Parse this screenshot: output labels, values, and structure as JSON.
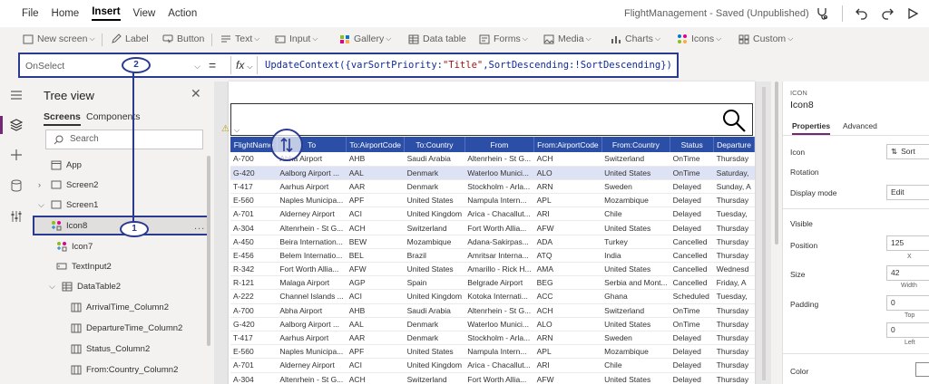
{
  "menu": {
    "items": [
      "File",
      "Home",
      "Insert",
      "View",
      "Action"
    ],
    "active": "Insert",
    "app_title": "FlightManagement - Saved (Unpublished)"
  },
  "toolbar": {
    "new_screen": "New screen",
    "label": "Label",
    "button": "Button",
    "text": "Text",
    "input": "Input",
    "gallery": "Gallery",
    "data_table": "Data table",
    "forms": "Forms",
    "media": "Media",
    "charts": "Charts",
    "icons": "Icons",
    "custom": "Custom"
  },
  "formula_bar": {
    "property": "OnSelect",
    "equals": "=",
    "fx": "fx",
    "formula_parts": {
      "a": "UpdateContext({varSortPriority:",
      "b": "\"Title\"",
      "c": ",SortDescending:!SortDescending})"
    }
  },
  "tree_view": {
    "title": "Tree view",
    "tabs": [
      "Screens",
      "Components"
    ],
    "search_placeholder": "Search",
    "nodes": [
      {
        "label": "App",
        "icon": "app-icon"
      },
      {
        "label": "Screen2",
        "icon": "screen-icon"
      },
      {
        "label": "Screen1",
        "icon": "screen-icon"
      },
      {
        "label": "Icon8",
        "icon": "icon-control-icon"
      },
      {
        "label": "Icon7",
        "icon": "icon-control-icon"
      },
      {
        "label": "TextInput2",
        "icon": "textinput-icon"
      },
      {
        "label": "DataTable2",
        "icon": "datatable-icon"
      },
      {
        "label": "ArrivalTime_Column2",
        "icon": "column-icon"
      },
      {
        "label": "DepartureTime_Column2",
        "icon": "column-icon"
      },
      {
        "label": "Status_Column2",
        "icon": "column-icon"
      },
      {
        "label": "From:Country_Column2",
        "icon": "column-icon"
      }
    ],
    "more": "..."
  },
  "annotations": {
    "marker1": "1",
    "marker2": "2"
  },
  "table": {
    "columns": [
      "FlightName",
      "To",
      "To:AirportCode",
      "To:Country",
      "From",
      "From:AirportCode",
      "From:Country",
      "Status",
      "Departure"
    ],
    "rows": [
      [
        "A-700",
        "Abha Airport",
        "AHB",
        "Saudi Arabia",
        "Altenrhein - St G...",
        "ACH",
        "Switzerland",
        "OnTime",
        "Thursday"
      ],
      [
        "G-420",
        "Aalborg Airport ...",
        "AAL",
        "Denmark",
        "Waterloo Munici...",
        "ALO",
        "United States",
        "OnTime",
        "Saturday,"
      ],
      [
        "T-417",
        "Aarhus Airport",
        "AAR",
        "Denmark",
        "Stockholm - Arla...",
        "ARN",
        "Sweden",
        "Delayed",
        "Sunday, A"
      ],
      [
        "E-560",
        "Naples Municipa...",
        "APF",
        "United States",
        "Nampula Intern...",
        "APL",
        "Mozambique",
        "Delayed",
        "Thursday"
      ],
      [
        "A-701",
        "Alderney Airport",
        "ACI",
        "United Kingdom",
        "Arica - Chacallut...",
        "ARI",
        "Chile",
        "Delayed",
        "Tuesday,"
      ],
      [
        "A-304",
        "Altenrhein - St G...",
        "ACH",
        "Switzerland",
        "Fort Worth Allia...",
        "AFW",
        "United States",
        "Delayed",
        "Thursday"
      ],
      [
        "A-450",
        "Beira Internation...",
        "BEW",
        "Mozambique",
        "Adana-Sakirpas...",
        "ADA",
        "Turkey",
        "Cancelled",
        "Thursday"
      ],
      [
        "E-456",
        "Belem Internatio...",
        "BEL",
        "Brazil",
        "Amritsar Interna...",
        "ATQ",
        "India",
        "Cancelled",
        "Thursday"
      ],
      [
        "R-342",
        "Fort Worth Allia...",
        "AFW",
        "United States",
        "Amarillo - Rick H...",
        "AMA",
        "United States",
        "Cancelled",
        "Wednesd"
      ],
      [
        "R-121",
        "Malaga Airport",
        "AGP",
        "Spain",
        "Belgrade Airport",
        "BEG",
        "Serbia and Mont...",
        "Cancelled",
        "Friday, A"
      ],
      [
        "A-222",
        "Channel Islands ...",
        "ACI",
        "United Kingdom",
        "Kotoka Internati...",
        "ACC",
        "Ghana",
        "Scheduled",
        "Tuesday,"
      ],
      [
        "A-700",
        "Abha Airport",
        "AHB",
        "Saudi Arabia",
        "Altenrhein - St G...",
        "ACH",
        "Switzerland",
        "OnTime",
        "Thursday"
      ],
      [
        "G-420",
        "Aalborg Airport ...",
        "AAL",
        "Denmark",
        "Waterloo Munici...",
        "ALO",
        "United States",
        "OnTime",
        "Thursday"
      ],
      [
        "T-417",
        "Aarhus Airport",
        "AAR",
        "Denmark",
        "Stockholm - Arla...",
        "ARN",
        "Sweden",
        "Delayed",
        "Thursday"
      ],
      [
        "E-560",
        "Naples Municipa...",
        "APF",
        "United States",
        "Nampula Intern...",
        "APL",
        "Mozambique",
        "Delayed",
        "Thursday"
      ],
      [
        "A-701",
        "Alderney Airport",
        "ACI",
        "United Kingdom",
        "Arica - Chacallut...",
        "ARI",
        "Chile",
        "Delayed",
        "Thursday"
      ],
      [
        "A-304",
        "Altenrhein - St G...",
        "ACH",
        "Switzerland",
        "Fort Worth Allia...",
        "AFW",
        "United States",
        "Delayed",
        "Thursday"
      ]
    ]
  },
  "properties": {
    "control_type": "ICON",
    "control_name": "Icon8",
    "tabs": [
      "Properties",
      "Advanced"
    ],
    "icon_label": "Icon",
    "icon_value": "Sort",
    "rotation_label": "Rotation",
    "display_mode_label": "Display mode",
    "display_mode_value": "Edit",
    "visible_label": "Visible",
    "position_label": "Position",
    "position_x": "125",
    "x_label": "X",
    "size_label": "Size",
    "size_w": "42",
    "width_label": "Width",
    "padding_label": "Padding",
    "padding_top": "0",
    "top_label": "Top",
    "padding_left": "0",
    "left_label": "Left",
    "color_label": "Color"
  }
}
